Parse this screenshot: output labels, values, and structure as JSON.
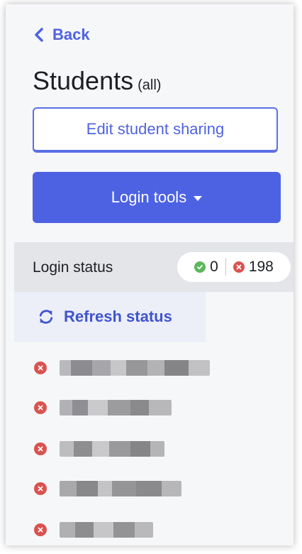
{
  "nav": {
    "back_label": "Back"
  },
  "header": {
    "title": "Students",
    "subtitle": "(all)"
  },
  "actions": {
    "edit_sharing_label": "Edit student sharing",
    "login_tools_label": "Login tools"
  },
  "login_status": {
    "label": "Login status",
    "logged_in_count": "0",
    "logged_out_count": "198",
    "refresh_label": "Refresh status"
  },
  "students": [
    {
      "name": "",
      "status": "logged-out"
    },
    {
      "name": "",
      "status": "logged-out"
    },
    {
      "name": "",
      "status": "logged-out"
    },
    {
      "name": "",
      "status": "logged-out"
    },
    {
      "name": "",
      "status": "logged-out"
    }
  ],
  "colors": {
    "accent": "#4d62e3",
    "ok": "#5cb85c",
    "error": "#d9534f"
  },
  "icons": {
    "back": "chevron-left-icon",
    "dropdown": "caret-down-icon",
    "ok": "check-circle-icon",
    "error": "x-circle-icon",
    "refresh": "refresh-icon"
  }
}
